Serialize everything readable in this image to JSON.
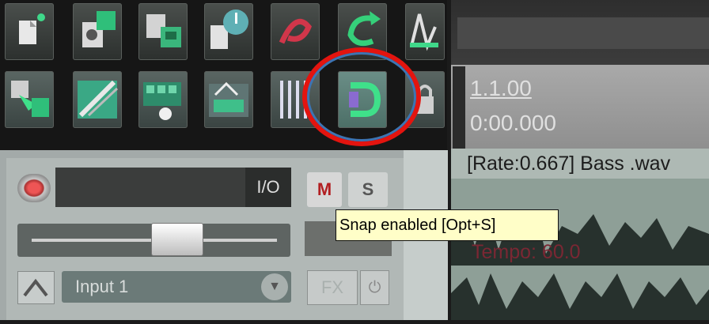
{
  "toolbar": {
    "row1": [
      {
        "icon": "new-project-icon"
      },
      {
        "icon": "open-project-icon"
      },
      {
        "icon": "save-project-icon"
      },
      {
        "icon": "project-settings-icon"
      },
      {
        "icon": "undo-icon"
      },
      {
        "icon": "redo-icon"
      },
      {
        "icon": "metronome-icon"
      }
    ],
    "row2": [
      {
        "icon": "auto-crossfade-icon"
      },
      {
        "icon": "ripple-edit-icon"
      },
      {
        "icon": "grouping-icon"
      },
      {
        "icon": "envelope-lock-icon"
      },
      {
        "icon": "grid-icon"
      },
      {
        "icon": "snap-icon"
      },
      {
        "icon": "lock-icon"
      }
    ]
  },
  "ruler": {
    "bar_label": "1.1.00",
    "time_label": "0:00.000"
  },
  "item": {
    "label": "[Rate:0.667] Bass .wav",
    "tempo_label": "Tempo: 60.0"
  },
  "track": {
    "io_label": "I/O",
    "mute_label": "M",
    "solo_label": "S",
    "input_label": "Input 1",
    "fx_label": "FX",
    "fader_position": 0.6
  },
  "tooltip": {
    "text": "Snap enabled [Opt+S]"
  },
  "colors": {
    "highlight_circle": "#e3140f",
    "inner_circle": "#3d74b3",
    "tooltip_bg": "#fffec8"
  }
}
